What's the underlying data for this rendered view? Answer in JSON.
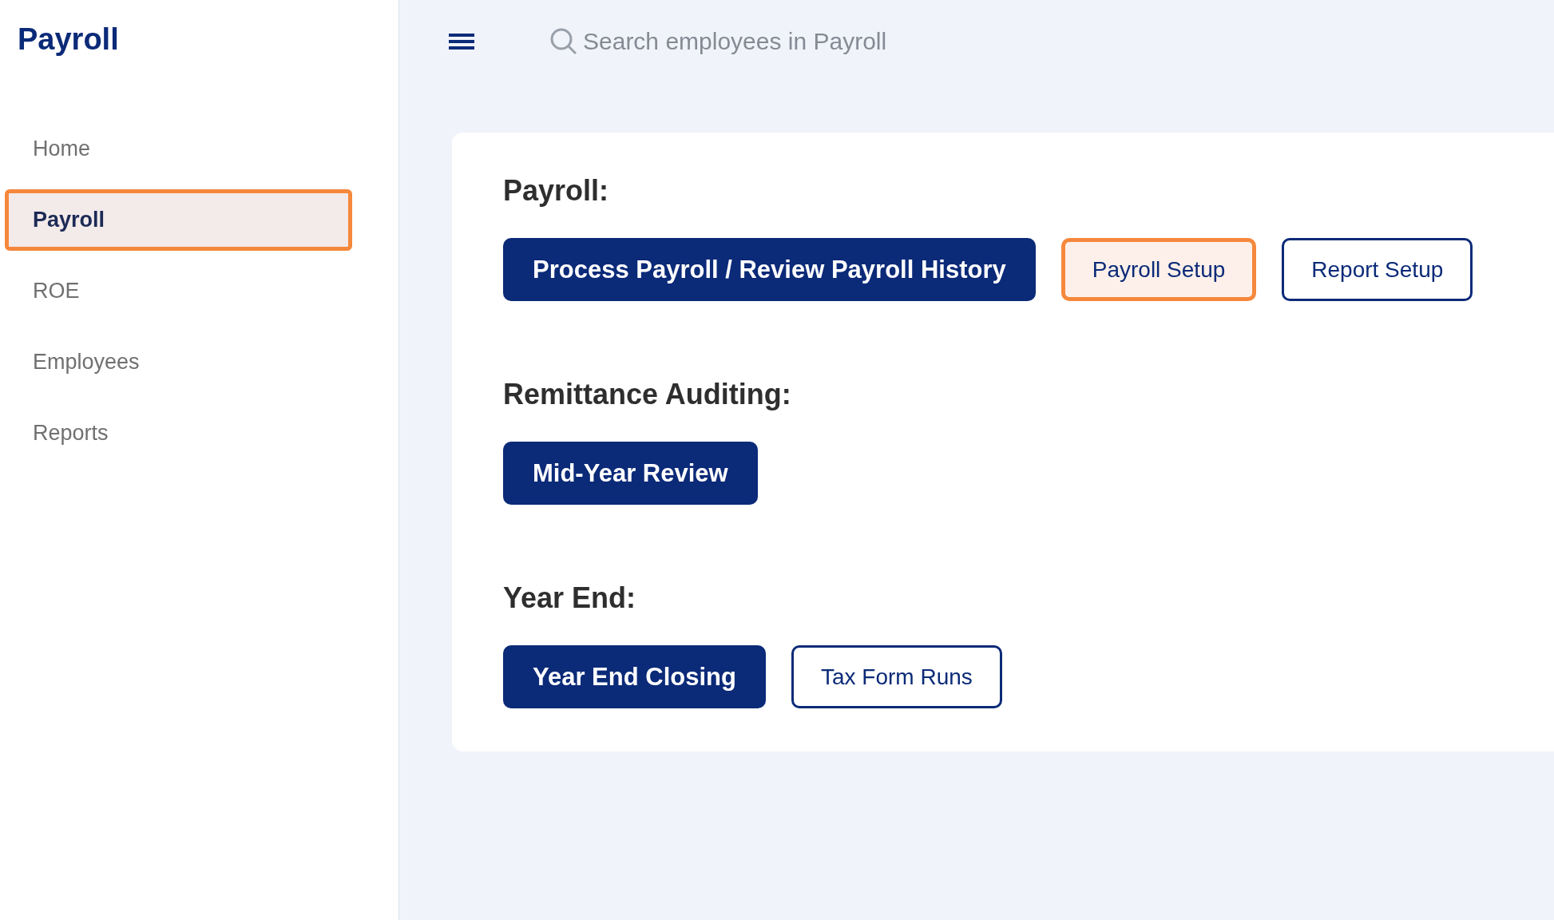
{
  "sidebar": {
    "title": "Payroll",
    "items": [
      {
        "label": "Home",
        "selected": false,
        "highlighted": false
      },
      {
        "label": "Payroll",
        "selected": true,
        "highlighted": true
      },
      {
        "label": "ROE",
        "selected": false,
        "highlighted": false
      },
      {
        "label": "Employees",
        "selected": false,
        "highlighted": false
      },
      {
        "label": "Reports",
        "selected": false,
        "highlighted": false
      }
    ]
  },
  "topbar": {
    "search": {
      "placeholder": "Search employees in Payroll"
    }
  },
  "sections": [
    {
      "heading": "Payroll:",
      "buttons": [
        {
          "label": "Process Payroll / Review Payroll History",
          "kind": "primary",
          "highlighted": false
        },
        {
          "label": "Payroll Setup",
          "kind": "outline",
          "highlighted": true
        },
        {
          "label": "Report Setup",
          "kind": "outline",
          "highlighted": false
        }
      ]
    },
    {
      "heading": "Remittance Auditing:",
      "buttons": [
        {
          "label": "Mid-Year Review",
          "kind": "primary",
          "highlighted": false
        }
      ]
    },
    {
      "heading": "Year End:",
      "buttons": [
        {
          "label": "Year End Closing",
          "kind": "primary",
          "highlighted": false
        },
        {
          "label": "Tax Form Runs",
          "kind": "outline",
          "highlighted": false
        }
      ]
    }
  ]
}
